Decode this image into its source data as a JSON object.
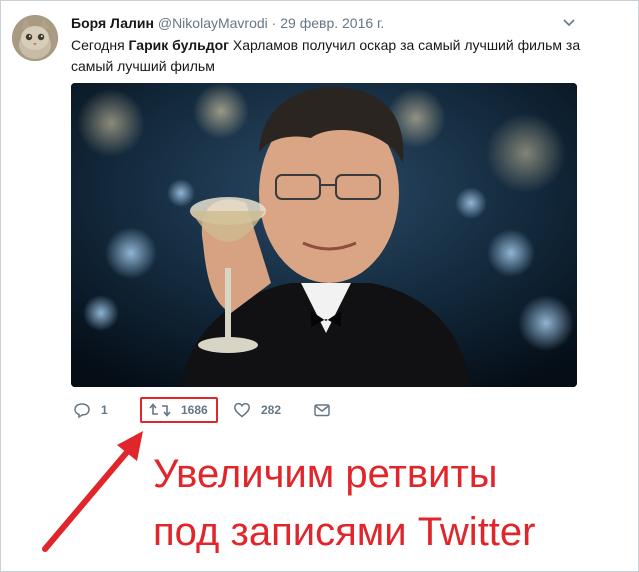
{
  "tweet": {
    "author_name": "Боря Лалин",
    "author_handle": "@NikolayMavrodi",
    "separator": "·",
    "date": "29 февр. 2016 г.",
    "text_before": "Сегодня ",
    "text_bold": "Гарик бульдог",
    "text_after": " Харламов получил оскар за самый лучший фильм за самый лучший фильм"
  },
  "actions": {
    "reply_count": "1",
    "retweet_count": "1686",
    "like_count": "282"
  },
  "annotation": {
    "line1": "Увеличим ретвиты",
    "line2": "под записями Twitter"
  },
  "colors": {
    "accent_red": "#e0262b",
    "muted": "#657786",
    "text": "#14171a"
  },
  "icons": [
    "chevron-down-icon",
    "reply-icon",
    "retweet-icon",
    "like-icon",
    "message-icon"
  ]
}
